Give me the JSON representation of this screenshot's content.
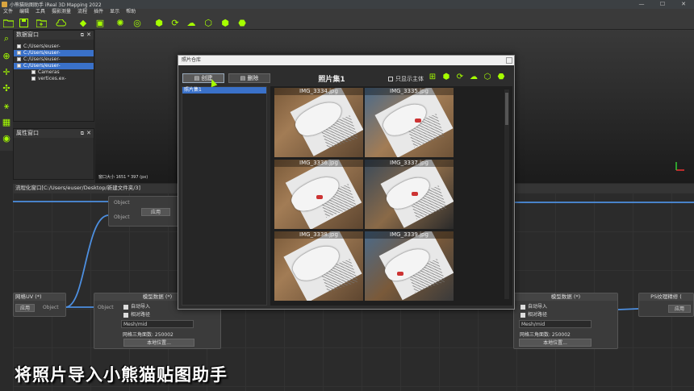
{
  "app": {
    "title": "小熊猫贴图助手 iReal 3D Mapping 2022",
    "win_min": "—",
    "win_max": "☐",
    "win_close": "✕"
  },
  "menu": [
    "文件",
    "编辑",
    "工具",
    "摄影测量",
    "流程",
    "插件",
    "显示",
    "帮助"
  ],
  "data_window": {
    "title": "数据窗口",
    "float_btn": "⧉",
    "close_btn": "✕",
    "items": [
      {
        "label": "C:/Users/euser-",
        "selected": false
      },
      {
        "label": "C:/Users/euser-",
        "selected": true
      },
      {
        "label": "C:/Users/euser-",
        "selected": false
      },
      {
        "label": "C:/Users/euser-",
        "selected": true
      },
      {
        "label": "Cameras",
        "selected": false
      },
      {
        "label": "vertices.ex-",
        "selected": false
      }
    ]
  },
  "property_window": {
    "title": "属性窗口",
    "float_btn": "⧉",
    "close_btn": "✕"
  },
  "viewport": {
    "size_text": "窗口大小 1651 * 397 (px)"
  },
  "flow_window": {
    "title": "流程化窗口[C:/Users/euser/Desktop/新建文件夹/3]"
  },
  "nodes": {
    "top_node": {
      "port_a": "Object",
      "port_b": "Object",
      "port_right": "Ob",
      "apply": "应用"
    },
    "left_node": {
      "title": "网格UV (*)",
      "apply": "应用",
      "port_out": "Object"
    },
    "model_left": {
      "title": "模型数据 (*)",
      "port_in": "Object",
      "auto_import": "自动导入",
      "relative_path": "相对路径",
      "mesh_field": "Mesh/mid",
      "tri_count": "网格三角面数: 250002",
      "local_btn": "本地位置..."
    },
    "model_right": {
      "title": "模型数据 (*)",
      "auto_import": "自动导入",
      "relative_path": "相对路径",
      "mesh_field": "Mesh/mid",
      "tri_count": "网格三角面数: 250002",
      "local_btn": "本地位置..."
    },
    "ps_node": {
      "title": "PS纹理精修 (",
      "apply": "应用"
    }
  },
  "dialog": {
    "title": "照片仓库",
    "create_btn": "创建",
    "delete_btn": "删除",
    "set_title": "照片集1",
    "show_main": "只显示主体",
    "set_items": [
      "照片集1"
    ],
    "photos": [
      "IMG_3334.jpg",
      "IMG_3335.jpg",
      "IMG_3336.jpg",
      "IMG_3337.jpg",
      "IMG_3338.jpg",
      "IMG_3339.jpg"
    ]
  },
  "caption": "将照片导入小熊猫贴图助手",
  "accent_color": "#a6ff00",
  "selection_color": "#3a71c9"
}
